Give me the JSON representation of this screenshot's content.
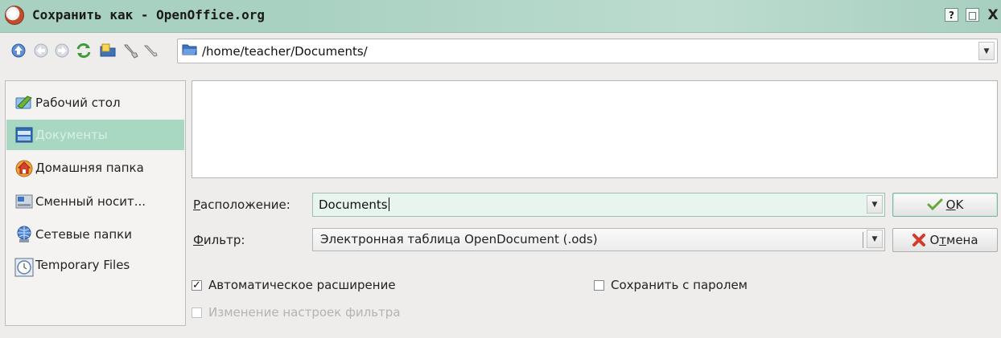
{
  "window": {
    "title": "Сохранить как - OpenOffice.org",
    "help_label": "?",
    "maximize_label": "□",
    "close_label": "X"
  },
  "toolbar": {
    "icons": [
      "up-icon",
      "back-icon",
      "forward-icon",
      "reload-icon",
      "new-folder-icon",
      "configure-icon"
    ],
    "path": "/home/teacher/Documents/"
  },
  "sidebar": {
    "items": [
      {
        "label": "Рабочий стол",
        "icon": "desktop-icon",
        "active": false
      },
      {
        "label": "Документы",
        "icon": "documents-icon",
        "active": true
      },
      {
        "label": "Домашняя папка",
        "icon": "home-icon",
        "active": false
      },
      {
        "label": "Сменный носит...",
        "icon": "removable-media-icon",
        "active": false
      },
      {
        "label": "Сетевые папки",
        "icon": "network-folder-icon",
        "active": false
      },
      {
        "label": "Temporary Files",
        "icon": "temp-folder-icon",
        "active": false
      }
    ]
  },
  "form": {
    "location_label_first": "Р",
    "location_label_rest": "асположение:",
    "location_value": "Documents",
    "filter_label_first": "Ф",
    "filter_label_rest": "ильтр:",
    "filter_value": "Электронная таблица OpenDocument (.ods)"
  },
  "buttons": {
    "ok_first": "O",
    "ok_rest": "K",
    "cancel_pre": "О",
    "cancel_ul": "т",
    "cancel_post": "мена"
  },
  "options": {
    "auto_extension": {
      "label": "Автоматическое расширение",
      "checked": true
    },
    "password": {
      "label": "Сохранить с паролем",
      "checked": false
    },
    "filter_options": {
      "label": "Изменение настроек фильтра",
      "checked": false,
      "disabled": true
    }
  },
  "colors": {
    "titlebar": "#a9d1c2",
    "selection": "#a8d8c1",
    "ok_check": "#66a83a",
    "cancel_x": "#d33b2a"
  }
}
